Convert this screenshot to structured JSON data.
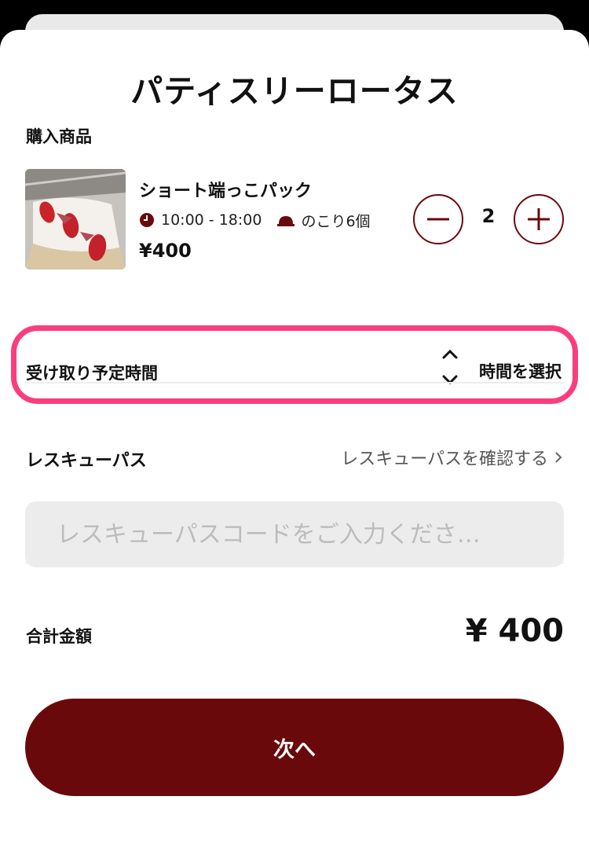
{
  "shop": {
    "name": "パティスリーロータス"
  },
  "cart": {
    "section_label": "購入商品",
    "item": {
      "name": "ショート端っこパック",
      "hours": "10:00 - 18:00",
      "stock": "のこり6個",
      "price": "¥400",
      "quantity": "2",
      "icons": {
        "clock": "clock-icon",
        "stock": "cloche-icon"
      }
    }
  },
  "pickup": {
    "label": "受け取り予定時間",
    "value": "時間を選択",
    "icon": "sort-chevrons-icon"
  },
  "rescue_pass": {
    "label": "レスキューパス",
    "link": "レスキューパスを確認する",
    "input_placeholder": "レスキューパスコードをご入力くださ…"
  },
  "total": {
    "label": "合計金額",
    "value": "¥ 400"
  },
  "actions": {
    "next": "次へ"
  },
  "colors": {
    "brand": "#69090c",
    "highlight": "#fa3e7c",
    "input_bg": "#ececec"
  }
}
